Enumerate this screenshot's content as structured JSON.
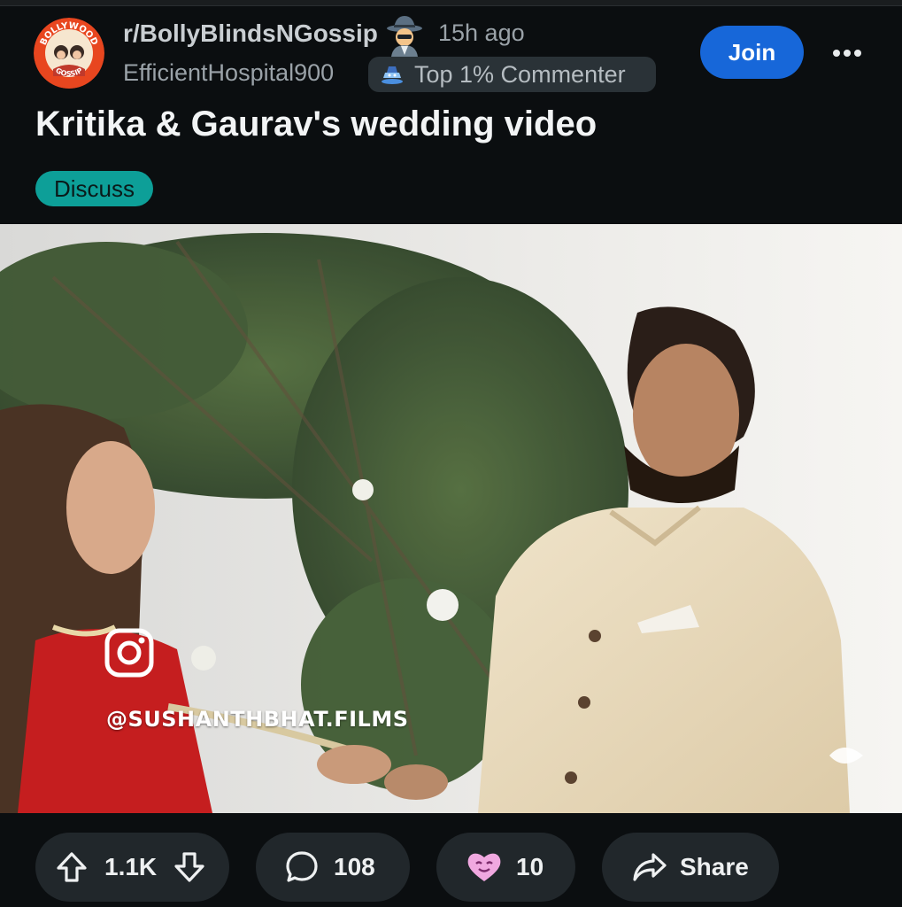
{
  "post": {
    "subreddit": "r/BollyBlindsNGossip",
    "subreddit_icon": "bollywood-gossip-logo",
    "subreddit_logo_text_top": "BOLLYWOOD",
    "subreddit_logo_text_bottom": "GOSSIP",
    "time_ago": "15h ago",
    "username": "EfficientHospital900",
    "user_flair": "Top 1% Commenter",
    "title": "Kritika & Gaurav's wedding video",
    "tag": "Discuss",
    "join_label": "Join",
    "more_icon": "more-options-icon"
  },
  "media": {
    "watermark": "@SUSHANTHBHAT.FILMS",
    "icon": "instagram-icon"
  },
  "actions": {
    "votes": "1.1K",
    "comments": "108",
    "awards": "10",
    "share_label": "Share"
  },
  "colors": {
    "background": "#0b0e10",
    "join_button": "#1767d9",
    "tag": "#0d9f98",
    "pill": "#21272b",
    "flair": "#2a3237"
  }
}
